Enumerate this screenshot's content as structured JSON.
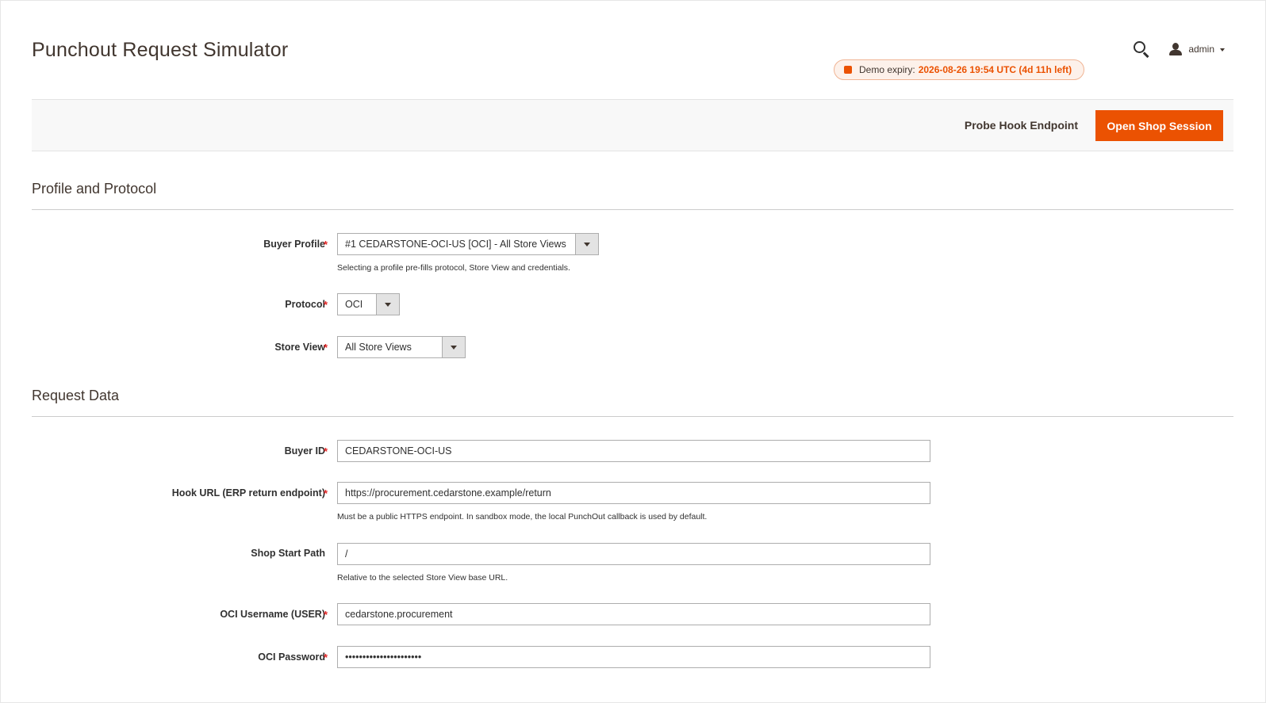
{
  "header": {
    "title": "Punchout Request Simulator",
    "user": "admin",
    "demo_label": "Demo expiry:",
    "demo_value": "2026-08-26 19:54 UTC (4d 11h left)"
  },
  "toolbar": {
    "probe_label": "Probe Hook Endpoint",
    "open_label": "Open Shop Session"
  },
  "sections": {
    "profile": {
      "title": "Profile and Protocol",
      "buyer_profile": {
        "label": "Buyer Profile",
        "value": "#1 CEDARSTONE-OCI-US [OCI] - All Store Views",
        "hint": "Selecting a profile pre-fills protocol, Store View and credentials."
      },
      "protocol": {
        "label": "Protocol",
        "value": "OCI"
      },
      "store_view": {
        "label": "Store View",
        "value": "All Store Views"
      }
    },
    "request": {
      "title": "Request Data",
      "buyer_id": {
        "label": "Buyer ID",
        "value": "CEDARSTONE-OCI-US"
      },
      "hook_url": {
        "label": "Hook URL (ERP return endpoint)",
        "value": "https://procurement.cedarstone.example/return",
        "hint": "Must be a public HTTPS endpoint. In sandbox mode, the local PunchOut callback is used by default."
      },
      "shop_start_path": {
        "label": "Shop Start Path",
        "value": "/",
        "hint": "Relative to the selected Store View base URL."
      },
      "oci_username": {
        "label": "OCI Username (USER)",
        "value": "cedarstone.procurement"
      },
      "oci_password": {
        "label": "OCI Password",
        "value": "••••••••••••••••••••••"
      }
    }
  },
  "required_mark": "*",
  "colors": {
    "accent": "#eb5202",
    "required": "#e22626"
  }
}
